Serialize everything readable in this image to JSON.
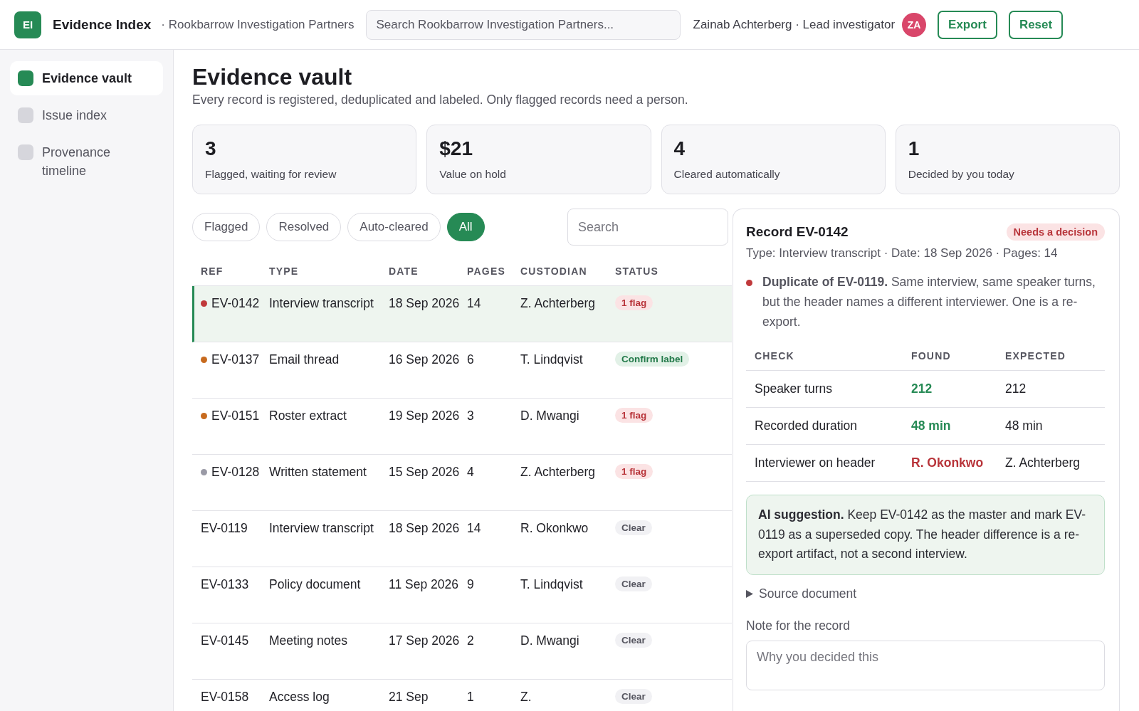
{
  "header": {
    "logo": "EI",
    "app_name": "Evidence Index",
    "organization": "· Rookbarrow Investigation Partners",
    "search": {
      "placeholder": "Search Rookbarrow Investigation Partners..."
    },
    "user": "Zainab Achterberg · Lead investigator",
    "avatar": "ZA",
    "buttons": [
      "Export",
      "Reset"
    ]
  },
  "sidebar": {
    "items": [
      {
        "label": "Evidence vault",
        "selected": true
      },
      {
        "label": "Issue index",
        "selected": false
      },
      {
        "label": "Provenance timeline",
        "selected": false
      }
    ]
  },
  "page": {
    "title": "Evidence vault",
    "subtitle": "Every record is registered, deduplicated and labeled. Only flagged records need a person."
  },
  "stats": [
    {
      "value": "3",
      "label": "Flagged, waiting for review"
    },
    {
      "value": "$21",
      "label": "Value on hold"
    },
    {
      "value": "4",
      "label": "Cleared automatically"
    },
    {
      "value": "1",
      "label": "Decided by you today"
    }
  ],
  "filters": [
    {
      "label": "Flagged",
      "selected": false
    },
    {
      "label": "Resolved",
      "selected": false
    },
    {
      "label": "Auto-cleared",
      "selected": false
    },
    {
      "label": "All",
      "selected": true
    }
  ],
  "table_search": {
    "placeholder": "Search"
  },
  "table": {
    "columns": [
      "REF",
      "TYPE",
      "DATE",
      "PAGES",
      "CUSTODIAN",
      "STATUS"
    ],
    "rows": [
      {
        "ref": "EV-0142",
        "color": "#c0393b",
        "type": "Interview transcript",
        "date": "18 Sep 2026",
        "pages": "14",
        "custodian": "Z. Achterberg",
        "status": {
          "kind": "flag",
          "label": "1 flag"
        },
        "selected": true
      },
      {
        "ref": "EV-0137",
        "color": "#c76a1e",
        "type": "Email thread",
        "date": "16 Sep 2026",
        "pages": "6",
        "custodian": "T. Lindqvist",
        "status": {
          "kind": "confirm",
          "label": "Confirm label"
        },
        "selected": false
      },
      {
        "ref": "EV-0151",
        "color": "#c76a1e",
        "type": "Roster extract",
        "date": "19 Sep 2026",
        "pages": "3",
        "custodian": "D. Mwangi",
        "status": {
          "kind": "flag",
          "label": "1 flag"
        },
        "selected": false
      },
      {
        "ref": "EV-0128",
        "color": "#9a9aa6",
        "type": "Written statement",
        "date": "15 Sep 2026",
        "pages": "4",
        "custodian": "Z. Achterberg",
        "status": {
          "kind": "flag",
          "label": "1 flag"
        },
        "selected": false
      },
      {
        "ref": "EV-0119",
        "type": "Interview transcript",
        "date": "18 Sep 2026",
        "pages": "14",
        "custodian": "R. Okonkwo",
        "status": {
          "kind": "clear",
          "label": "Clear"
        },
        "selected": false
      },
      {
        "ref": "EV-0133",
        "type": "Policy document",
        "date": "11 Sep 2026",
        "pages": "9",
        "custodian": "T. Lindqvist",
        "status": {
          "kind": "clear",
          "label": "Clear"
        },
        "selected": false
      },
      {
        "ref": "EV-0145",
        "type": "Meeting notes",
        "date": "17 Sep 2026",
        "pages": "2",
        "custodian": "D. Mwangi",
        "status": {
          "kind": "clear",
          "label": "Clear"
        },
        "selected": false
      },
      {
        "ref": "EV-0158",
        "type": "Access log",
        "date": "21 Sep",
        "pages": "1",
        "custodian": "Z.",
        "status": {
          "kind": "clear",
          "label": "Clear"
        },
        "selected": false
      }
    ]
  },
  "detail": {
    "title": "Record EV-0142",
    "badge": "Needs a decision",
    "meta": "Type: Interview transcript · Date: 18 Sep 2026 · Pages: 14",
    "finding": {
      "color": "#c0393b",
      "text": "**Duplicate of EV-0119.** Same interview, same speaker turns, but the header names a different interviewer. One is a re-export."
    },
    "checks": {
      "columns": [
        "CHECK",
        "FOUND",
        "EXPECTED"
      ],
      "rows": [
        {
          "check": "Speaker turns",
          "found": "212",
          "expected": "212",
          "match": true
        },
        {
          "check": "Recorded duration",
          "found": "48 min",
          "expected": "48 min",
          "match": true
        },
        {
          "check": "Interviewer on header",
          "found": "R. Okonkwo",
          "expected": "Z. Achterberg",
          "match": false
        }
      ]
    },
    "suggestion": "**AI suggestion.** Keep EV-0142 as the master and mark EV-0119 as a superseded copy. The header difference is a re-export artifact, not a second interview.",
    "source": {
      "label": "Source document",
      "expanded": false
    },
    "note": {
      "label": "Note for the record",
      "placeholder": "Why you decided this"
    }
  }
}
